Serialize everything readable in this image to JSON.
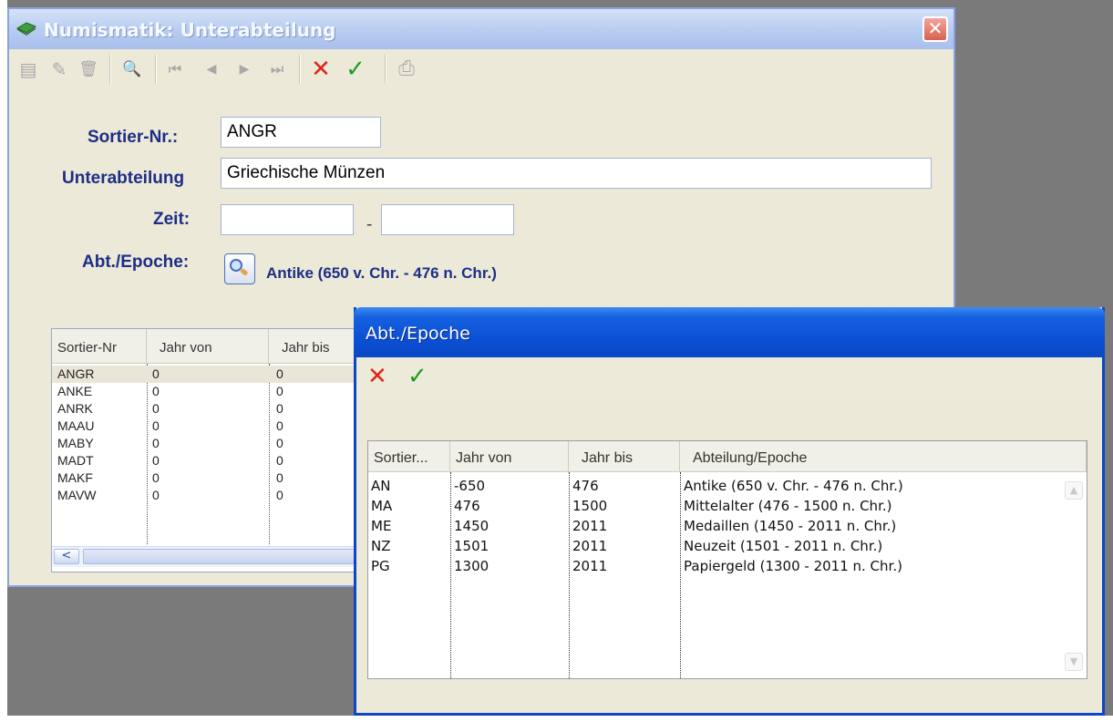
{
  "main_window": {
    "title": "Numismatik: Unterabteilung",
    "close_glyph": "✕",
    "toolbar": {
      "new_glyph": "▤",
      "edit_glyph": "✎",
      "delete_glyph": "🗑",
      "find_glyph": "🔍",
      "first_glyph": "⏮",
      "prev_glyph": "◀",
      "next_glyph": "▶",
      "last_glyph": "⏭",
      "cancel_glyph": "✕",
      "ok_glyph": "✓",
      "print_glyph": "⎙"
    },
    "form": {
      "sortier_label": "Sortier-Nr.:",
      "sortier_value": "ANGR",
      "unterabteilung_label": "Unterabteilung",
      "unterabteilung_value": "Griechische Münzen",
      "zeit_label": "Zeit:",
      "zeit_from": "",
      "zeit_dash": "-",
      "zeit_to": "",
      "epoche_label": "Abt./Epoche:",
      "epoche_value": "Antike (650 v. Chr. - 476 n. Chr.)"
    },
    "grid": {
      "headers": [
        "Sortier-Nr",
        "Jahr von",
        "Jahr bis"
      ],
      "rows": [
        [
          "ANGR",
          "0",
          "0"
        ],
        [
          "ANKE",
          "0",
          "0"
        ],
        [
          "ANRK",
          "0",
          "0"
        ],
        [
          "MAAU",
          "0",
          "0"
        ],
        [
          "MABY",
          "0",
          "0"
        ],
        [
          "MADT",
          "0",
          "0"
        ],
        [
          "MAKF",
          "0",
          "0"
        ],
        [
          "MAVW",
          "0",
          "0"
        ]
      ],
      "scroll_left_glyph": "<"
    }
  },
  "dialog": {
    "title": "Abt./Epoche",
    "cancel_glyph": "✕",
    "ok_glyph": "✓",
    "grid": {
      "headers": [
        "Sortier...",
        "Jahr von",
        "Jahr bis",
        "Abteilung/Epoche"
      ],
      "rows": [
        [
          "AN",
          "-650",
          "476",
          "Antike (650 v. Chr. - 476 n. Chr.)"
        ],
        [
          "MA",
          "476",
          "1500",
          "Mittelalter (476 - 1500 n. Chr.)"
        ],
        [
          "ME",
          "1450",
          "2011",
          "Medaillen (1450 - 2011 n. Chr.)"
        ],
        [
          "NZ",
          "1501",
          "2011",
          "Neuzeit (1501 - 2011 n. Chr.)"
        ],
        [
          "PG",
          "1300",
          "2011",
          "Papiergeld (1300 - 2011 n. Chr.)"
        ]
      ],
      "scroll_up_glyph": "▲",
      "scroll_down_glyph": "▼"
    }
  },
  "colors": {
    "label_blue": "#1c2e86",
    "cancel_red": "#e0241a",
    "ok_green": "#1f9a1f",
    "dialog_title_blue": "#0a4ed2"
  }
}
